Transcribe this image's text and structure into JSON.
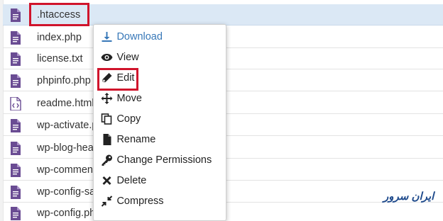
{
  "files": [
    {
      "name": ".htaccess",
      "icon": "file-text-icon",
      "selected": true
    },
    {
      "name": "index.php",
      "icon": "file-text-icon"
    },
    {
      "name": "license.txt",
      "icon": "file-text-icon"
    },
    {
      "name": "phpinfo.php",
      "icon": "file-text-icon"
    },
    {
      "name": "readme.html",
      "icon": "file-code-icon"
    },
    {
      "name": "wp-activate.p",
      "icon": "file-text-icon"
    },
    {
      "name": "wp-blog-hea",
      "icon": "file-text-icon"
    },
    {
      "name": "wp-commen",
      "icon": "file-text-icon"
    },
    {
      "name": "wp-config-sa",
      "icon": "file-text-icon"
    },
    {
      "name": "wp-config.ph",
      "icon": "file-text-icon"
    }
  ],
  "context_menu": {
    "download": "Download",
    "view": "View",
    "edit": "Edit",
    "move": "Move",
    "copy": "Copy",
    "rename": "Rename",
    "change_permissions": "Change Permissions",
    "delete": "Delete",
    "compress": "Compress"
  },
  "watermark": "ایران سرور",
  "colors": {
    "file_icon": "#6a4c93",
    "highlight": "#d0142c",
    "download_link": "#3878b8",
    "selected_row": "#dbe8f5"
  }
}
